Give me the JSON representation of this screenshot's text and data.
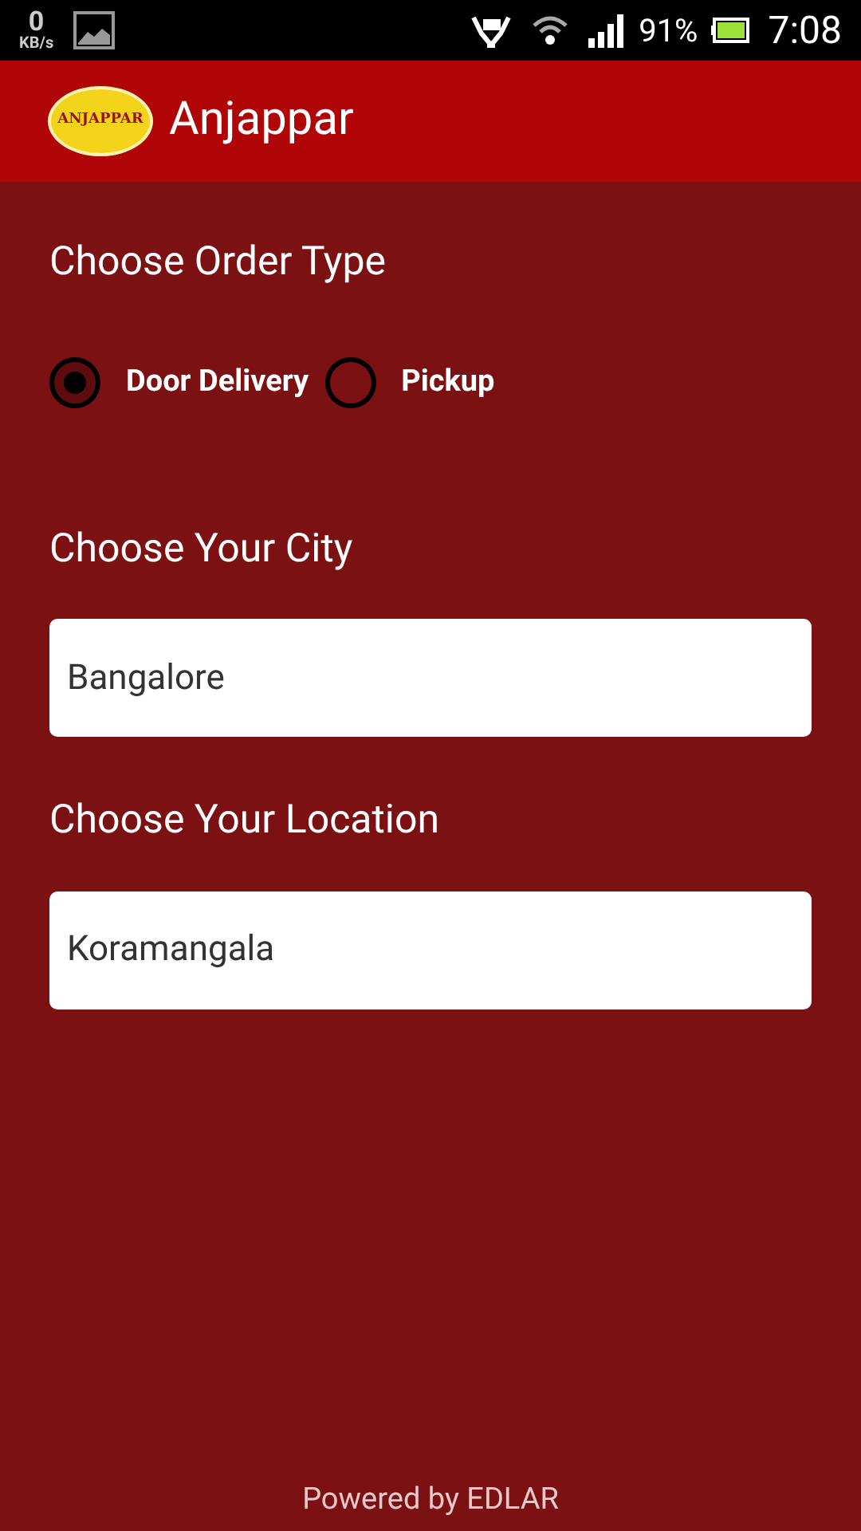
{
  "status_bar": {
    "speed": "0",
    "speed_unit": "KB/s",
    "battery": "91%",
    "time": "7:08"
  },
  "app_bar": {
    "logo_text": "ANJAPPAR",
    "title": "Anjappar"
  },
  "order_type": {
    "heading": "Choose Order Type",
    "options": [
      {
        "label": "Door Delivery",
        "selected": true
      },
      {
        "label": "Pickup",
        "selected": false
      }
    ]
  },
  "fields": [
    {
      "heading": "Choose Your City",
      "value": "Bangalore"
    },
    {
      "heading": "Choose Your Location",
      "value": "Koramangala"
    }
  ],
  "footer": "Powered by EDLAR"
}
